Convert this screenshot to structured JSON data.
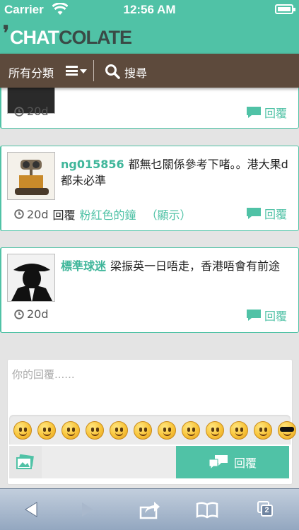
{
  "status_bar": {
    "carrier": "Carrier",
    "time": "12:56 AM"
  },
  "brand": {
    "logo_part1": "CHAT",
    "logo_part2": "COLATE"
  },
  "nav": {
    "category_label": "所有分類",
    "search_label": "搜尋"
  },
  "comments": [
    {
      "user": "",
      "text": "",
      "time": "20d",
      "reply_label": "回覆"
    },
    {
      "user": "ng015856",
      "text": "都無乜關係參考下啫。。港大果d都未必準",
      "time": "20d",
      "inline_reply": "回覆",
      "reply_to": "粉紅色的鐘",
      "show_label": "（顯示）",
      "reply_label": "回覆"
    },
    {
      "user": "標準球迷",
      "text": "梁振英一日唔走，香港唔會有前途",
      "time": "20d",
      "reply_label": "回覆"
    }
  ],
  "composer": {
    "placeholder": "你的回覆......",
    "send_label": "回覆",
    "emoji_count": 12
  },
  "colors": {
    "accent": "#50c2a6",
    "nav_bg": "#5d4a3c",
    "toolbar_bg": "#93a7c0"
  },
  "toolbar": {
    "tabs_count": "2"
  }
}
